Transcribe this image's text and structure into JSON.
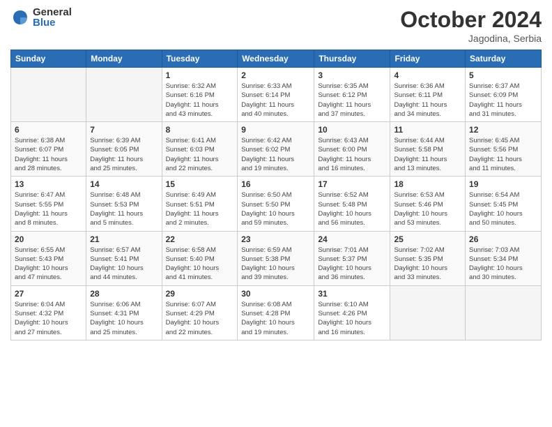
{
  "header": {
    "logo_general": "General",
    "logo_blue": "Blue",
    "title": "October 2024",
    "location": "Jagodina, Serbia"
  },
  "weekdays": [
    "Sunday",
    "Monday",
    "Tuesday",
    "Wednesday",
    "Thursday",
    "Friday",
    "Saturday"
  ],
  "weeks": [
    [
      {
        "day": "",
        "info": ""
      },
      {
        "day": "",
        "info": ""
      },
      {
        "day": "1",
        "info": "Sunrise: 6:32 AM\nSunset: 6:16 PM\nDaylight: 11 hours\nand 43 minutes."
      },
      {
        "day": "2",
        "info": "Sunrise: 6:33 AM\nSunset: 6:14 PM\nDaylight: 11 hours\nand 40 minutes."
      },
      {
        "day": "3",
        "info": "Sunrise: 6:35 AM\nSunset: 6:12 PM\nDaylight: 11 hours\nand 37 minutes."
      },
      {
        "day": "4",
        "info": "Sunrise: 6:36 AM\nSunset: 6:11 PM\nDaylight: 11 hours\nand 34 minutes."
      },
      {
        "day": "5",
        "info": "Sunrise: 6:37 AM\nSunset: 6:09 PM\nDaylight: 11 hours\nand 31 minutes."
      }
    ],
    [
      {
        "day": "6",
        "info": "Sunrise: 6:38 AM\nSunset: 6:07 PM\nDaylight: 11 hours\nand 28 minutes."
      },
      {
        "day": "7",
        "info": "Sunrise: 6:39 AM\nSunset: 6:05 PM\nDaylight: 11 hours\nand 25 minutes."
      },
      {
        "day": "8",
        "info": "Sunrise: 6:41 AM\nSunset: 6:03 PM\nDaylight: 11 hours\nand 22 minutes."
      },
      {
        "day": "9",
        "info": "Sunrise: 6:42 AM\nSunset: 6:02 PM\nDaylight: 11 hours\nand 19 minutes."
      },
      {
        "day": "10",
        "info": "Sunrise: 6:43 AM\nSunset: 6:00 PM\nDaylight: 11 hours\nand 16 minutes."
      },
      {
        "day": "11",
        "info": "Sunrise: 6:44 AM\nSunset: 5:58 PM\nDaylight: 11 hours\nand 13 minutes."
      },
      {
        "day": "12",
        "info": "Sunrise: 6:45 AM\nSunset: 5:56 PM\nDaylight: 11 hours\nand 11 minutes."
      }
    ],
    [
      {
        "day": "13",
        "info": "Sunrise: 6:47 AM\nSunset: 5:55 PM\nDaylight: 11 hours\nand 8 minutes."
      },
      {
        "day": "14",
        "info": "Sunrise: 6:48 AM\nSunset: 5:53 PM\nDaylight: 11 hours\nand 5 minutes."
      },
      {
        "day": "15",
        "info": "Sunrise: 6:49 AM\nSunset: 5:51 PM\nDaylight: 11 hours\nand 2 minutes."
      },
      {
        "day": "16",
        "info": "Sunrise: 6:50 AM\nSunset: 5:50 PM\nDaylight: 10 hours\nand 59 minutes."
      },
      {
        "day": "17",
        "info": "Sunrise: 6:52 AM\nSunset: 5:48 PM\nDaylight: 10 hours\nand 56 minutes."
      },
      {
        "day": "18",
        "info": "Sunrise: 6:53 AM\nSunset: 5:46 PM\nDaylight: 10 hours\nand 53 minutes."
      },
      {
        "day": "19",
        "info": "Sunrise: 6:54 AM\nSunset: 5:45 PM\nDaylight: 10 hours\nand 50 minutes."
      }
    ],
    [
      {
        "day": "20",
        "info": "Sunrise: 6:55 AM\nSunset: 5:43 PM\nDaylight: 10 hours\nand 47 minutes."
      },
      {
        "day": "21",
        "info": "Sunrise: 6:57 AM\nSunset: 5:41 PM\nDaylight: 10 hours\nand 44 minutes."
      },
      {
        "day": "22",
        "info": "Sunrise: 6:58 AM\nSunset: 5:40 PM\nDaylight: 10 hours\nand 41 minutes."
      },
      {
        "day": "23",
        "info": "Sunrise: 6:59 AM\nSunset: 5:38 PM\nDaylight: 10 hours\nand 39 minutes."
      },
      {
        "day": "24",
        "info": "Sunrise: 7:01 AM\nSunset: 5:37 PM\nDaylight: 10 hours\nand 36 minutes."
      },
      {
        "day": "25",
        "info": "Sunrise: 7:02 AM\nSunset: 5:35 PM\nDaylight: 10 hours\nand 33 minutes."
      },
      {
        "day": "26",
        "info": "Sunrise: 7:03 AM\nSunset: 5:34 PM\nDaylight: 10 hours\nand 30 minutes."
      }
    ],
    [
      {
        "day": "27",
        "info": "Sunrise: 6:04 AM\nSunset: 4:32 PM\nDaylight: 10 hours\nand 27 minutes."
      },
      {
        "day": "28",
        "info": "Sunrise: 6:06 AM\nSunset: 4:31 PM\nDaylight: 10 hours\nand 25 minutes."
      },
      {
        "day": "29",
        "info": "Sunrise: 6:07 AM\nSunset: 4:29 PM\nDaylight: 10 hours\nand 22 minutes."
      },
      {
        "day": "30",
        "info": "Sunrise: 6:08 AM\nSunset: 4:28 PM\nDaylight: 10 hours\nand 19 minutes."
      },
      {
        "day": "31",
        "info": "Sunrise: 6:10 AM\nSunset: 4:26 PM\nDaylight: 10 hours\nand 16 minutes."
      },
      {
        "day": "",
        "info": ""
      },
      {
        "day": "",
        "info": ""
      }
    ]
  ]
}
